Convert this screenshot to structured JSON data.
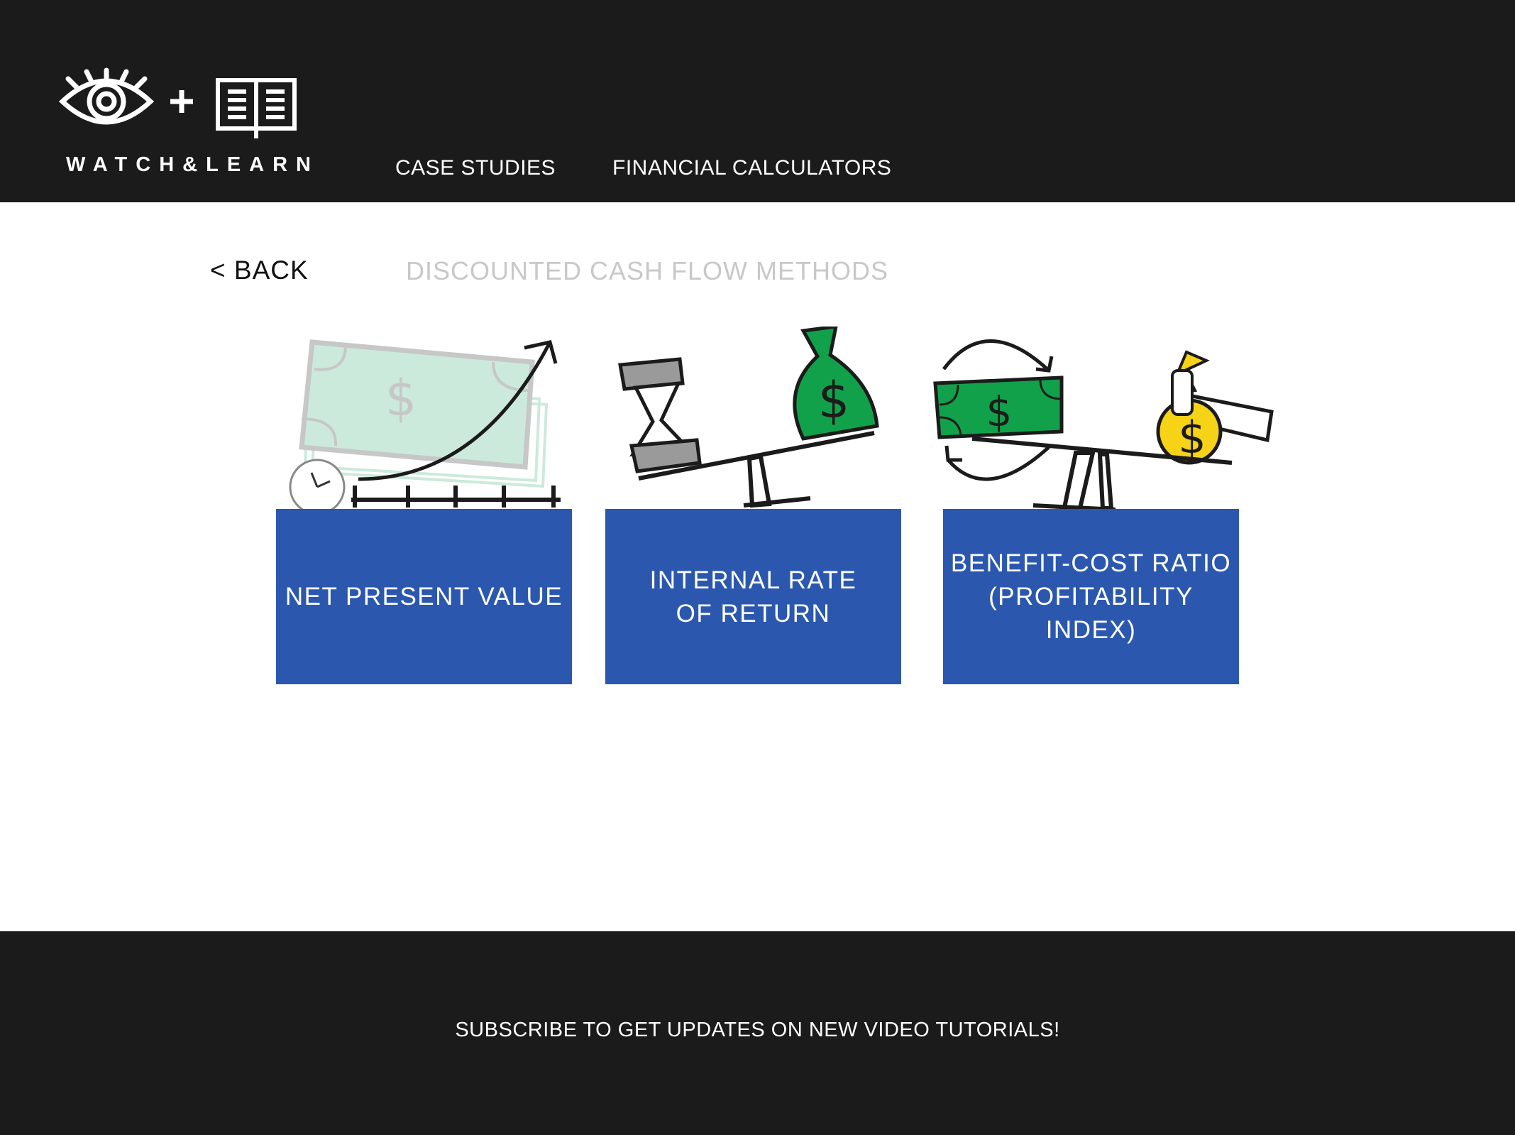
{
  "brand": {
    "name": "WATCH&LEARN",
    "plus": "+"
  },
  "nav": {
    "items": [
      {
        "label": "CASE STUDIES"
      },
      {
        "label": "FINANCIAL CALCULATORS"
      }
    ]
  },
  "main": {
    "back_label": "< BACK",
    "page_title": "DISCOUNTED CASH FLOW METHODS",
    "cards": [
      {
        "label_line1": "NET PRESENT VALUE",
        "label_line2": "",
        "dollar": "$"
      },
      {
        "label_line1": "INTERNAL RATE",
        "label_line2": "OF RETURN",
        "dollar": "$"
      },
      {
        "label_line1": "BENEFIT-COST RATIO",
        "label_line2": "(PROFITABILITY INDEX)",
        "dollar": "$"
      }
    ]
  },
  "footer": {
    "subscribe": "SUBSCRIBE TO GET UPDATES ON NEW VIDEO TUTORIALS!"
  },
  "colors": {
    "header_bg": "#1b1b1b",
    "card_bg": "#2b58ae",
    "money_green": "#12a14b",
    "pale_green": "#cbeadb",
    "gold": "#f6d316",
    "title_gray": "#c8c8c8"
  },
  "icons": {
    "logo": [
      "eye-icon",
      "plus-icon",
      "book-icon"
    ],
    "card1": [
      "banknote-icon",
      "growth-arrow-icon",
      "clock-icon",
      "timeline-icon"
    ],
    "card2": [
      "hourglass-icon",
      "money-bag-icon",
      "seesaw-icon"
    ],
    "card3": [
      "banknote-icon",
      "cycle-arrows-icon",
      "hand-money-bag-icon",
      "seesaw-icon"
    ]
  }
}
